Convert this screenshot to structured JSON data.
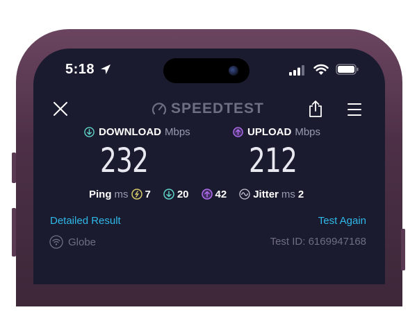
{
  "status_bar": {
    "time": "5:18"
  },
  "header": {
    "logo_text": "SPEEDTEST"
  },
  "download": {
    "label": "DOWNLOAD",
    "unit": "Mbps",
    "value": "232"
  },
  "upload": {
    "label": "UPLOAD",
    "unit": "Mbps",
    "value": "212"
  },
  "latency": {
    "ping_label": "Ping",
    "ping_unit": "ms",
    "idle": "7",
    "download": "20",
    "upload": "42",
    "jitter_label": "Jitter",
    "jitter_unit": "ms",
    "jitter": "2"
  },
  "links": {
    "detailed_result": "Detailed Result",
    "test_again": "Test Again"
  },
  "footer": {
    "isp": "Globe",
    "test_id": "Test ID: 6169947168"
  },
  "colors": {
    "download_accent": "#5fd3c8",
    "upload_accent": "#b06bf0",
    "ping_accent": "#d8c96a",
    "link": "#2fb8e8",
    "screen_bg": "#1b1b2f"
  },
  "icons": [
    "location-arrow-icon",
    "signal-icon",
    "wifi-icon",
    "battery-icon",
    "close-icon",
    "gauge-icon",
    "share-icon",
    "menu-icon",
    "download-arrow-icon",
    "upload-arrow-icon",
    "idle-ping-icon",
    "jitter-icon",
    "isp-wifi-icon"
  ]
}
